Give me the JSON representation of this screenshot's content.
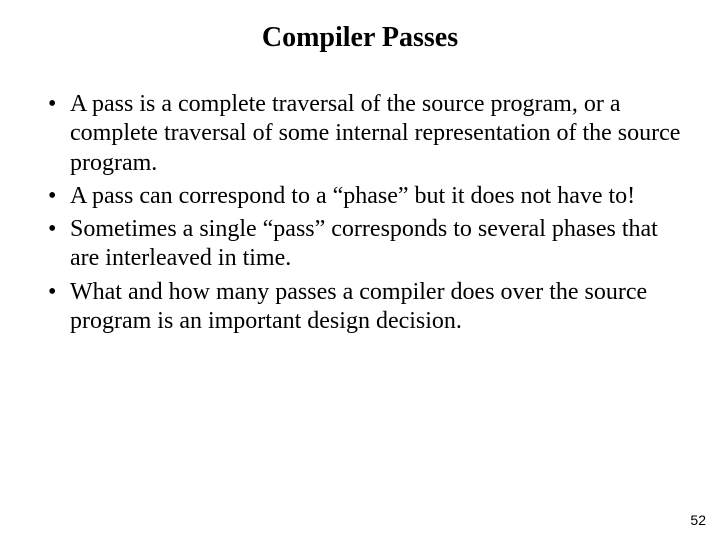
{
  "title": "Compiler Passes",
  "bullets": [
    "A pass is a complete traversal of the source program, or a complete traversal of some internal representation of the source program.",
    "A pass can correspond to a “phase” but it does not have to!",
    "Sometimes a single “pass” corresponds to several phases that are interleaved in time.",
    "What and how many passes a compiler does over the source program is an important design decision."
  ],
  "page_number": "52"
}
